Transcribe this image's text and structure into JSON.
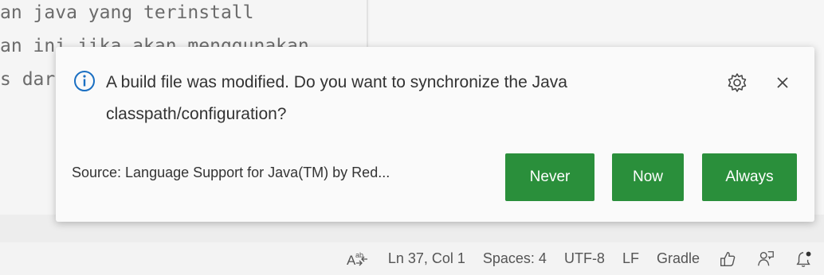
{
  "editor": {
    "code_lines": [
      "an java yang terinstall",
      "an ini jika akan menggunakan",
      "s dar"
    ]
  },
  "notification": {
    "message": "A build file was modified. Do you want to synchronize the Java classpath/configuration?",
    "source": "Source: Language Support for Java(TM) by Red...",
    "buttons": {
      "never": "Never",
      "now": "Now",
      "always": "Always"
    },
    "icons": {
      "info": "info-icon",
      "settings": "gear-icon",
      "close": "close-icon"
    },
    "accent_color": "#2a8f3b"
  },
  "status_bar": {
    "cursor": "Ln 37, Col 1",
    "indent": "Spaces: 4",
    "encoding": "UTF-8",
    "eol": "LF",
    "language": "Gradle",
    "icons": [
      "spell-check-icon",
      "feedback-like-icon",
      "accounts-icon",
      "notifications-icon"
    ]
  }
}
